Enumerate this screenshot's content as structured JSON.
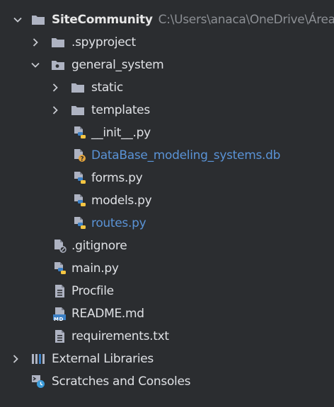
{
  "project_tree": {
    "root": {
      "name": "SiteCommunity",
      "path": "C:\\Users\\anaca\\OneDrive\\Área"
    },
    "items": [
      {
        "label": ".spyproject"
      },
      {
        "label": "general_system"
      },
      {
        "label": "static"
      },
      {
        "label": "templates"
      },
      {
        "label": "__init__.py"
      },
      {
        "label": "DataBase_modeling_systems.db"
      },
      {
        "label": "forms.py"
      },
      {
        "label": "models.py"
      },
      {
        "label": "routes.py"
      },
      {
        "label": ".gitignore"
      },
      {
        "label": "main.py"
      },
      {
        "label": "Procfile"
      },
      {
        "label": "README.md"
      },
      {
        "label": "requirements.txt"
      },
      {
        "label": "External Libraries"
      },
      {
        "label": "Scratches and Consoles"
      }
    ]
  },
  "icons": {
    "md_badge": "MD"
  },
  "colors": {
    "background": "#2b2d30",
    "text": "#dfe1e5",
    "highlight_text": "#5a93d6",
    "folder": "#aeb3c2",
    "python_blue": "#3b7fc4",
    "python_yellow": "#f4c542"
  }
}
